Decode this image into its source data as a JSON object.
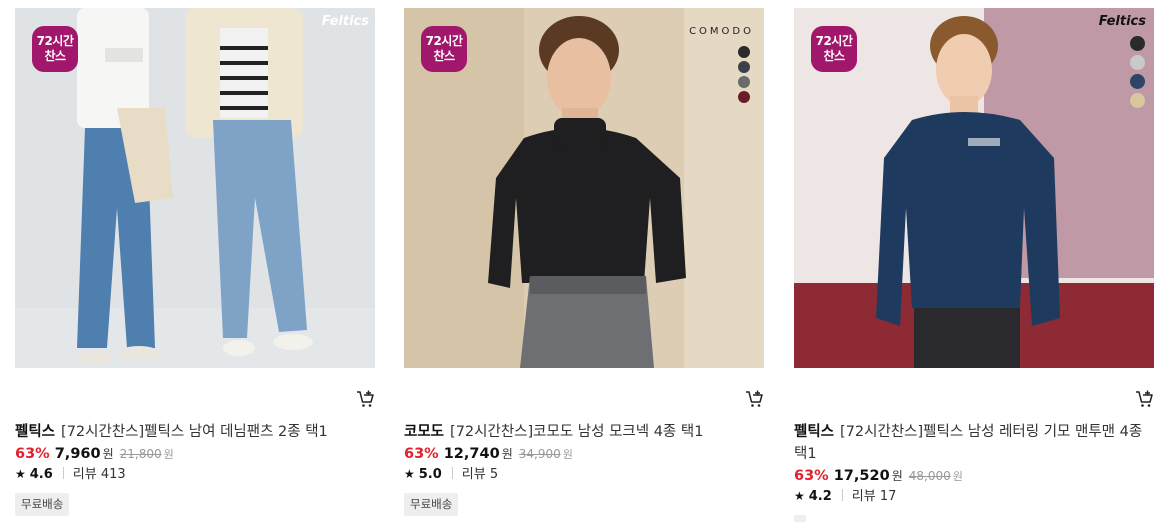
{
  "products": [
    {
      "badge": "72시간\n찬스",
      "watermark": "Feltics",
      "brand": "펠틱스",
      "name": "[72시간찬스]펠틱스 남여 데님팬츠 2종 택1",
      "discount": "63%",
      "price": "7,960",
      "currency": "원",
      "original_price": "21,800",
      "original_currency": "원",
      "star_icon": "star-icon",
      "rating": "4.6",
      "review_label": "리뷰 413",
      "shipping": "무료배송"
    },
    {
      "badge": "72시간\n찬스",
      "watermark": "COMODO",
      "color_swatches": [
        "#2b2b2b",
        "#3c4048",
        "#6a6a6a",
        "#6b1c2a"
      ],
      "brand": "코모도",
      "name": "[72시간찬스]코모도 남성 모크넥 4종 택1",
      "discount": "63%",
      "price": "12,740",
      "currency": "원",
      "original_price": "34,900",
      "original_currency": "원",
      "star_icon": "star-icon",
      "rating": "5.0",
      "review_label": "리뷰 5",
      "shipping": "무료배송"
    },
    {
      "badge": "72시간\n찬스",
      "watermark": "Feltics",
      "color_swatches": [
        "#2a2a2a",
        "#c9c9c9",
        "#2f4566",
        "#d8c79a"
      ],
      "brand": "펠틱스",
      "name": "[72시간찬스]펠틱스 남성 레터링 기모 맨투맨 4종 택1",
      "discount": "63%",
      "price": "17,520",
      "currency": "원",
      "original_price": "48,000",
      "original_currency": "원",
      "star_icon": "star-icon",
      "rating": "4.2",
      "review_label": "리뷰 17",
      "shipping": ""
    }
  ],
  "colors": {
    "badge": "#a0176b",
    "discount": "#e5202e"
  },
  "cart_icon": "cart-plus-icon"
}
